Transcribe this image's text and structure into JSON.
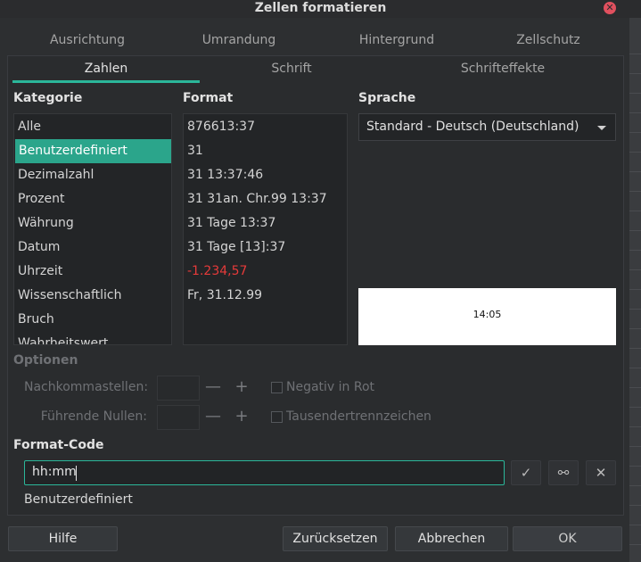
{
  "window": {
    "title": "Zellen formatieren",
    "close_icon": "close-icon",
    "close_color": "#e0505e"
  },
  "tabs_row1": [
    "Ausrichtung",
    "Umrandung",
    "Hintergrund",
    "Zellschutz"
  ],
  "tabs_row2": [
    "Zahlen",
    "Schrift",
    "Schrifteffekte"
  ],
  "active_tab": "Zahlen",
  "accent_color": "#2bb79a",
  "kategorie": {
    "label": "Kategorie",
    "items": [
      "Alle",
      "Benutzerdefiniert",
      "Dezimalzahl",
      "Prozent",
      "Währung",
      "Datum",
      "Uhrzeit",
      "Wissenschaftlich",
      "Bruch",
      "Wahrheitswert"
    ],
    "selected": "Benutzerdefiniert"
  },
  "format": {
    "label": "Format",
    "items": [
      "876613:37",
      "31",
      "31 13:37:46",
      "31 31an. Chr.99 13:37",
      "31 Tage 13:37",
      "31 Tage [13]:37",
      "-1.234,57",
      "Fr, 31.12.99"
    ],
    "negative_color": "#e63a3a"
  },
  "sprache": {
    "label": "Sprache",
    "value": "Standard - Deutsch (Deutschland)"
  },
  "preview": {
    "text": "14:05"
  },
  "optionen": {
    "label": "Optionen",
    "nachkommastellen_label": "Nachkommastellen:",
    "fuehrende_nullen_label": "Führende Nullen:",
    "negativ_in_rot_label": "Negativ in Rot",
    "tausender_label": "Tausendertrennzeichen",
    "negativ_in_rot_checked": false,
    "tausender_checked": false
  },
  "format_code": {
    "label": "Format-Code",
    "value": "hh:mm",
    "description": "Benutzerdefiniert"
  },
  "buttons": {
    "help": "Hilfe",
    "reset": "Zurücksetzen",
    "cancel": "Abbrechen",
    "ok": "OK"
  }
}
